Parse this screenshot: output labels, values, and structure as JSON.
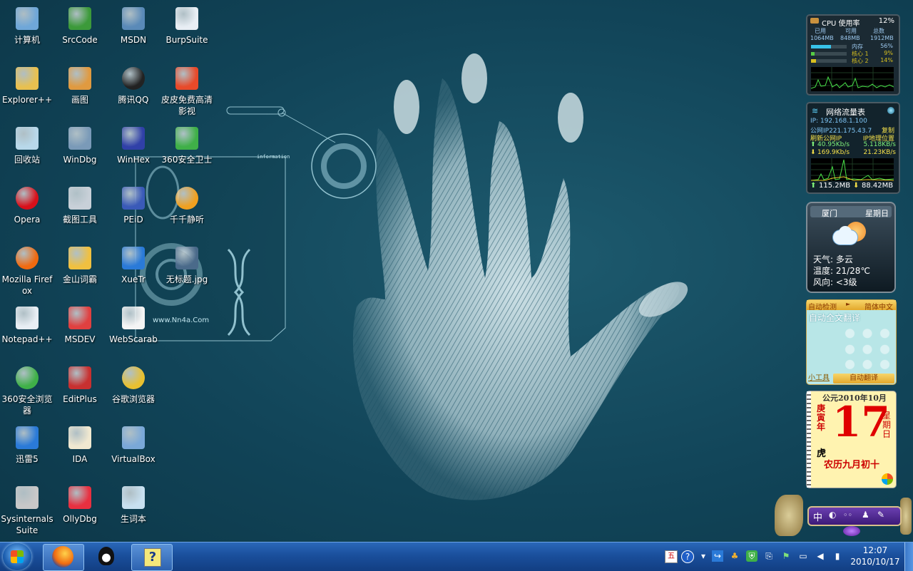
{
  "desktop": {
    "icons": [
      {
        "label": "计算机",
        "icon": "computer-icon"
      },
      {
        "label": "SrcCode",
        "icon": "tree-icon"
      },
      {
        "label": "MSDN",
        "icon": "msdn-icon"
      },
      {
        "label": "BurpSuite",
        "icon": "document-icon"
      },
      {
        "label": "Explorer++",
        "icon": "folder-icon"
      },
      {
        "label": "画图",
        "icon": "paint-icon"
      },
      {
        "label": "腾讯QQ",
        "icon": "qq-penguin-icon"
      },
      {
        "label": "皮皮免费高清影视",
        "icon": "video-player-icon"
      },
      {
        "label": "回收站",
        "icon": "recycle-bin-icon"
      },
      {
        "label": "WinDbg",
        "icon": "windbg-icon"
      },
      {
        "label": "WinHex",
        "icon": "winhex-icon"
      },
      {
        "label": "360安全卫士",
        "icon": "shield-icon"
      },
      {
        "label": "Opera",
        "icon": "opera-icon"
      },
      {
        "label": "截图工具",
        "icon": "scissors-icon"
      },
      {
        "label": "PEiD",
        "icon": "peid-icon"
      },
      {
        "label": "千千静听",
        "icon": "music-player-icon"
      },
      {
        "label": "Mozilla Firefox",
        "icon": "firefox-icon"
      },
      {
        "label": "金山词霸",
        "icon": "dictionary-icon"
      },
      {
        "label": "XueTr",
        "icon": "xuetr-icon"
      },
      {
        "label": "无标题.jpg",
        "icon": "image-file-icon"
      },
      {
        "label": "Notepad++",
        "icon": "notepad-icon"
      },
      {
        "label": "MSDEV",
        "icon": "msdev-icon"
      },
      {
        "label": "WebScarab",
        "icon": "java-icon"
      },
      {
        "label": "360安全浏览器",
        "icon": "browser-e-icon"
      },
      {
        "label": "EditPlus",
        "icon": "editplus-icon"
      },
      {
        "label": "谷歌浏览器",
        "icon": "chrome-icon"
      },
      {
        "label": "迅雷5",
        "icon": "thunder-icon"
      },
      {
        "label": "IDA",
        "icon": "ida-icon"
      },
      {
        "label": "VirtualBox",
        "icon": "virtualbox-icon"
      },
      {
        "label": "Sysinternals Suite",
        "icon": "sysinternals-icon"
      },
      {
        "label": "OllyDbg",
        "icon": "ollydbg-icon"
      },
      {
        "label": "生词本",
        "icon": "vocabulary-icon"
      }
    ]
  },
  "wallpaper": {
    "site_text": "www.Nn4a.Com",
    "panel_text": "information"
  },
  "cpu_gadget": {
    "title": "CPU 使用率",
    "percent": "12%",
    "used_label": "已用",
    "avail_label": "可用",
    "total_label": "总数",
    "used": "1064MB",
    "avail": "848MB",
    "total": "1912MB",
    "mem_label": "内存",
    "mem_value": "56%",
    "core1_label": "核心 1",
    "core1_value": "9%",
    "core2_label": "核心 2",
    "core2_value": "14%",
    "mem_frac": 0.56,
    "core1_frac": 0.09,
    "core2_frac": 0.14
  },
  "net_gadget": {
    "title": "网络流量表",
    "ip": "IP: 192.168.1.100",
    "public_ip": "公网IP221.175.43.7",
    "copy": "复制",
    "refresh": "刷新公网IP",
    "location": "IP地理位置",
    "up_rate": "40.95Kb/s",
    "up_rate2": "5.118KB/s",
    "down_rate": "169.9Kb/s",
    "down_rate2": "21.23KB/s",
    "up_total": "115.2MB",
    "down_total": "88.42MB"
  },
  "weather_gadget": {
    "city": "厦门",
    "weekday": "星期日",
    "weather": "天气: 多云",
    "temp": "温度: 21/28℃",
    "wind": "风向: <3级"
  },
  "translate_gadget": {
    "auto_detect": "自动检测",
    "lang": "简体中文",
    "full_text": "自动全文翻译",
    "tools": "小工具",
    "auto_translate": "自动翻译"
  },
  "calendar_gadget": {
    "header": "公元2010年10月",
    "year_gz": "庚寅年",
    "zodiac": "虎",
    "day": "17",
    "weekday": "星期日",
    "lunar": "农历九月初十"
  },
  "language_bar": {
    "text": "中"
  },
  "taskbar": {
    "buttons": [
      "firefox",
      "qq",
      "help"
    ],
    "time": "12:07",
    "date": "2010/10/17"
  }
}
